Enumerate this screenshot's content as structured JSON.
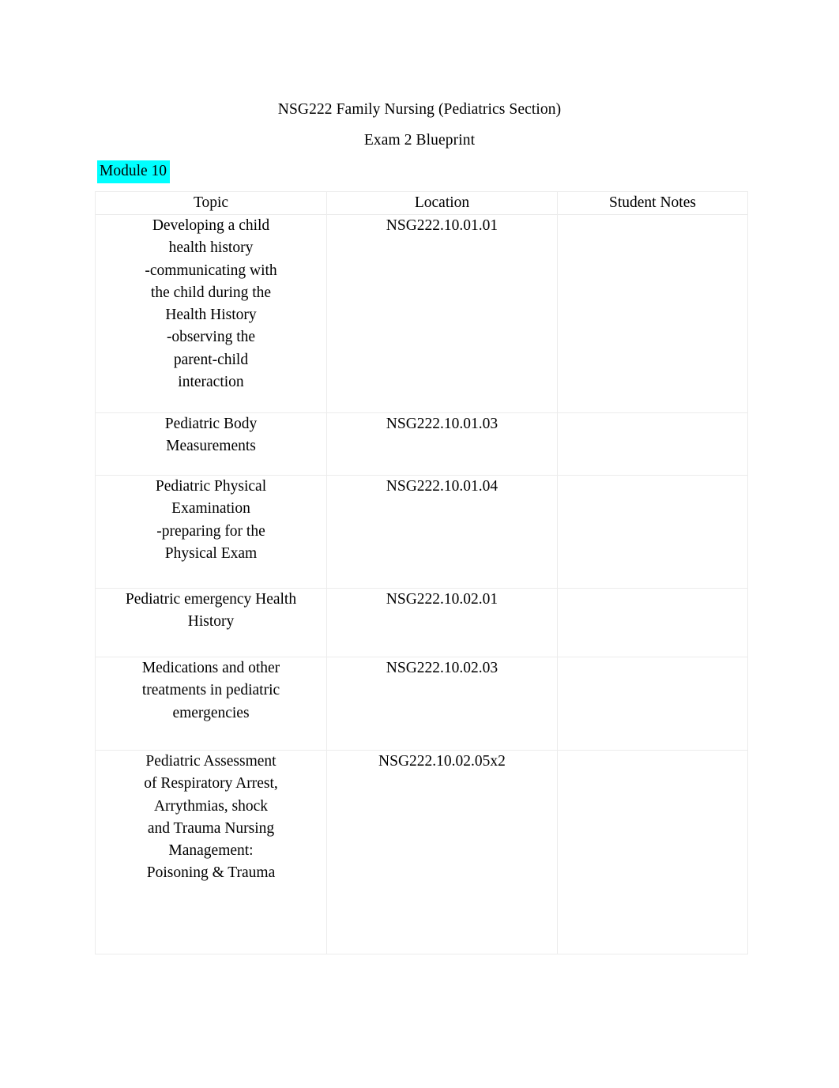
{
  "document": {
    "title_line_1": "NSG222 Family Nursing (Pediatrics Section)",
    "title_line_2": "Exam 2 Blueprint",
    "module_heading": "Module 10",
    "highlight_color": "#00FFFF",
    "text_color": "#000000",
    "border_color": "#ECECEC",
    "page_background": "#FFFFFF"
  },
  "table": {
    "headers": {
      "topic": "Topic",
      "location": "Location",
      "notes": "Student Notes"
    },
    "rows": [
      {
        "topic": "Developing a child health history\n-communicating with the child during the Health History\n-observing the parent-child interaction",
        "location": "NSG222.10.01.01",
        "notes": ""
      },
      {
        "topic": "Pediatric Body Measurements",
        "location": "NSG222.10.01.03",
        "notes": ""
      },
      {
        "topic": "Pediatric Physical Examination\n-preparing for the Physical Exam",
        "location": "NSG222.10.01.04",
        "notes": ""
      },
      {
        "topic": "Pediatric emergency Health History",
        "location": "NSG222.10.02.01",
        "notes": ""
      },
      {
        "topic": "Medications and other treatments in pediatric emergencies",
        "location": "NSG222.10.02.03",
        "notes": ""
      },
      {
        "topic": "Pediatric Assessment of Respiratory Arrest, Arrythmias, shock and Trauma Nursing Management: Poisoning & Trauma",
        "location": "NSG222.10.02.05x2",
        "notes": ""
      }
    ]
  }
}
